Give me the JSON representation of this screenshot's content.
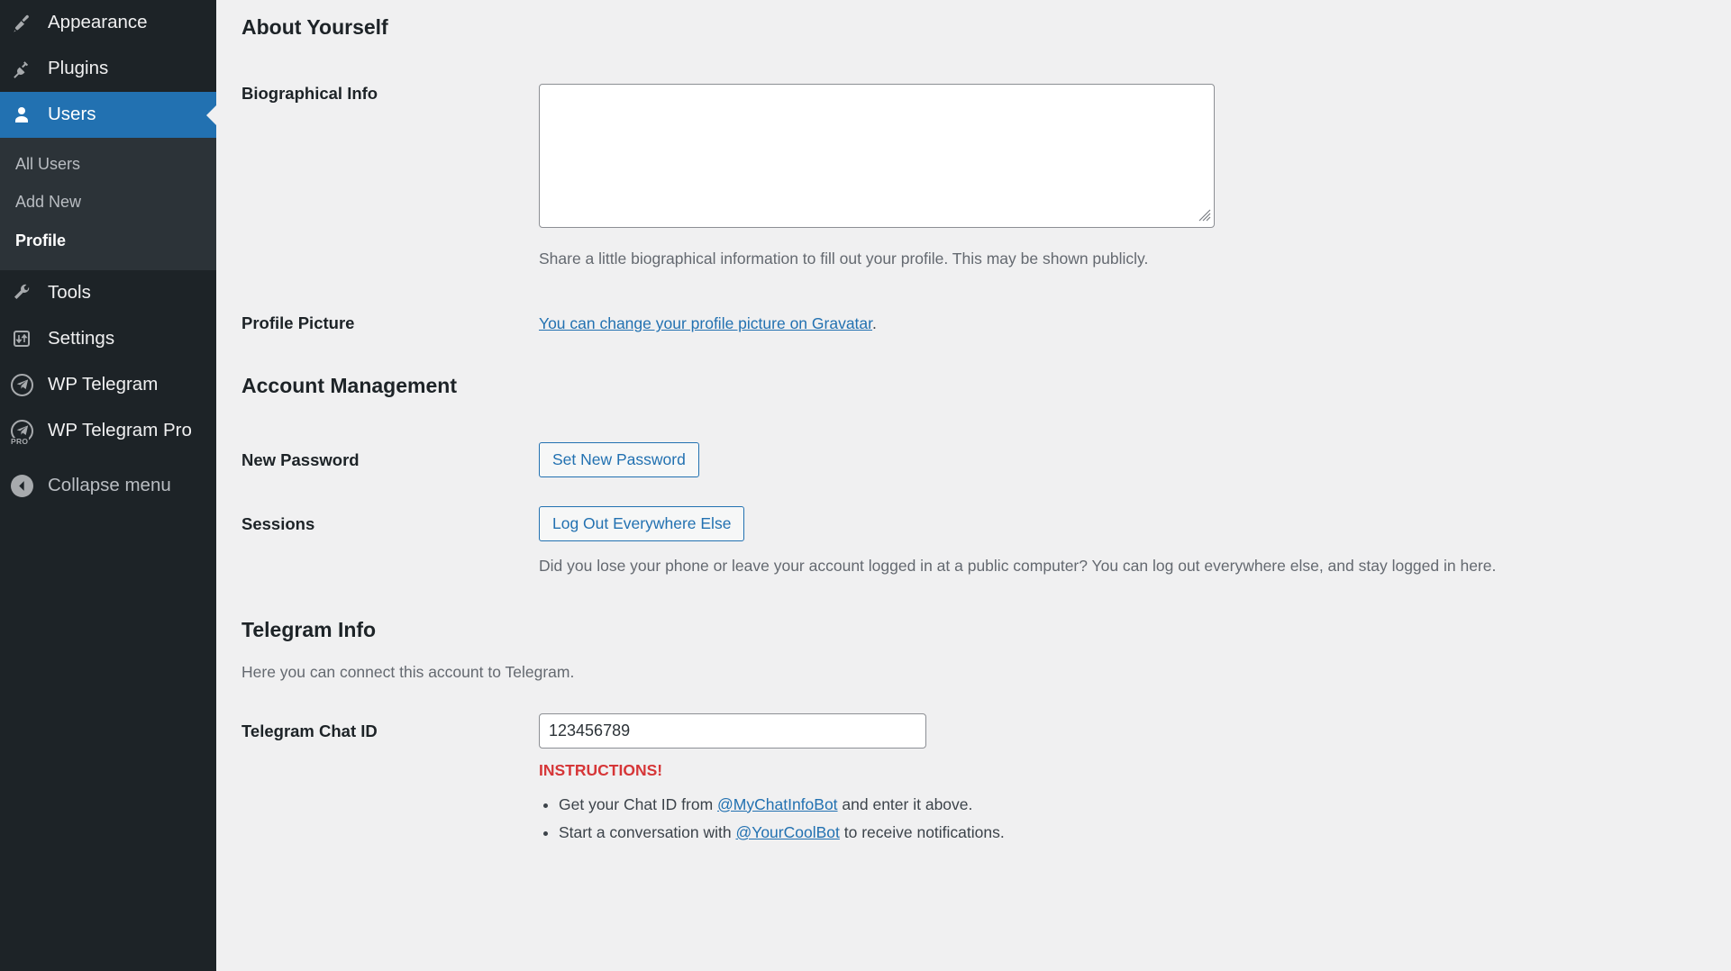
{
  "sidebar": {
    "items": [
      {
        "label": "Appearance",
        "icon": "paintbrush-icon",
        "active": false
      },
      {
        "label": "Plugins",
        "icon": "plug-icon",
        "active": false
      },
      {
        "label": "Users",
        "icon": "user-icon",
        "active": true
      },
      {
        "label": "Tools",
        "icon": "wrench-icon",
        "active": false
      },
      {
        "label": "Settings",
        "icon": "sliders-icon",
        "active": false
      },
      {
        "label": "WP Telegram",
        "icon": "telegram-icon",
        "active": false
      },
      {
        "label": "WP Telegram Pro",
        "icon": "telegram-pro-icon",
        "active": false
      }
    ],
    "submenu": [
      {
        "label": "All Users",
        "current": false
      },
      {
        "label": "Add New",
        "current": false
      },
      {
        "label": "Profile",
        "current": true
      }
    ],
    "pro_badge": "PRO",
    "collapse": {
      "label": "Collapse menu",
      "icon": "collapse-arrow-icon"
    },
    "colors": {
      "background": "#1d2327",
      "submenu_background": "#2c3338",
      "active": "#2271b1",
      "text": "#f0f0f1",
      "muted_text": "#b9bdc2"
    }
  },
  "main": {
    "about": {
      "heading": "About Yourself",
      "bio_label": "Biographical Info",
      "bio_value": "",
      "bio_description": "Share a little biographical information to fill out your profile. This may be shown publicly.",
      "picture_label": "Profile Picture",
      "picture_link_text": "You can change your profile picture on Gravatar",
      "picture_link_suffix": "."
    },
    "account": {
      "heading": "Account Management",
      "password_label": "New Password",
      "password_button": "Set New Password",
      "sessions_label": "Sessions",
      "sessions_button": "Log Out Everywhere Else",
      "sessions_description": "Did you lose your phone or leave your account logged in at a public computer? You can log out everywhere else, and stay logged in here."
    },
    "telegram": {
      "heading": "Telegram Info",
      "description": "Here you can connect this account to Telegram.",
      "chat_id_label": "Telegram Chat ID",
      "chat_id_value": "123456789",
      "instructions_title": "INSTRUCTIONS!",
      "instructions": [
        {
          "prefix": "Get your Chat ID from ",
          "link": "@MyChatInfoBot",
          "suffix": " and enter it above."
        },
        {
          "prefix": "Start a conversation with ",
          "link": "@YourCoolBot",
          "suffix": " to receive notifications."
        }
      ],
      "instructions_color": "#d63638"
    }
  }
}
